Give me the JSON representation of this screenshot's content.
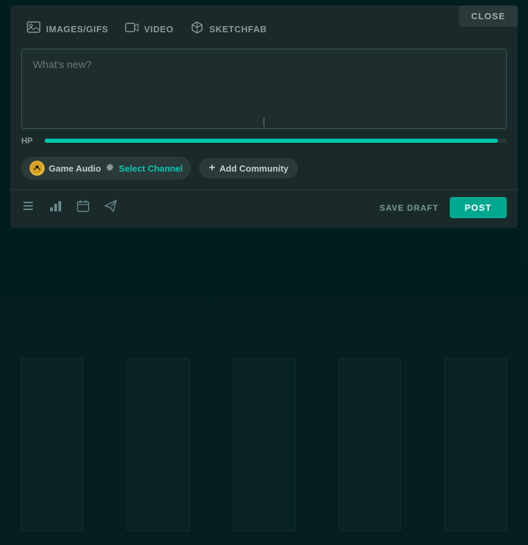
{
  "modal": {
    "close_label": "CLOSE",
    "toolbar": {
      "images_label": "IMAGES/GIFS",
      "video_label": "VIDEO",
      "sketchfab_label": "SKETCHFAB"
    },
    "textarea": {
      "placeholder": "What's new?"
    },
    "hp": {
      "label": "HP",
      "fill_percent": 98
    },
    "channel": {
      "community_name": "Game Audio",
      "select_channel_label": "Select Channel"
    },
    "add_community": {
      "label": "Add Community"
    },
    "bottom": {
      "save_draft_label": "SAVE DRAFT",
      "post_label": "POST"
    }
  },
  "icons": {
    "images": "🖼",
    "video": "🎬",
    "sketchfab": "📦",
    "list": "≡",
    "chart": "📊",
    "calendar": "📅",
    "send": "✉"
  }
}
